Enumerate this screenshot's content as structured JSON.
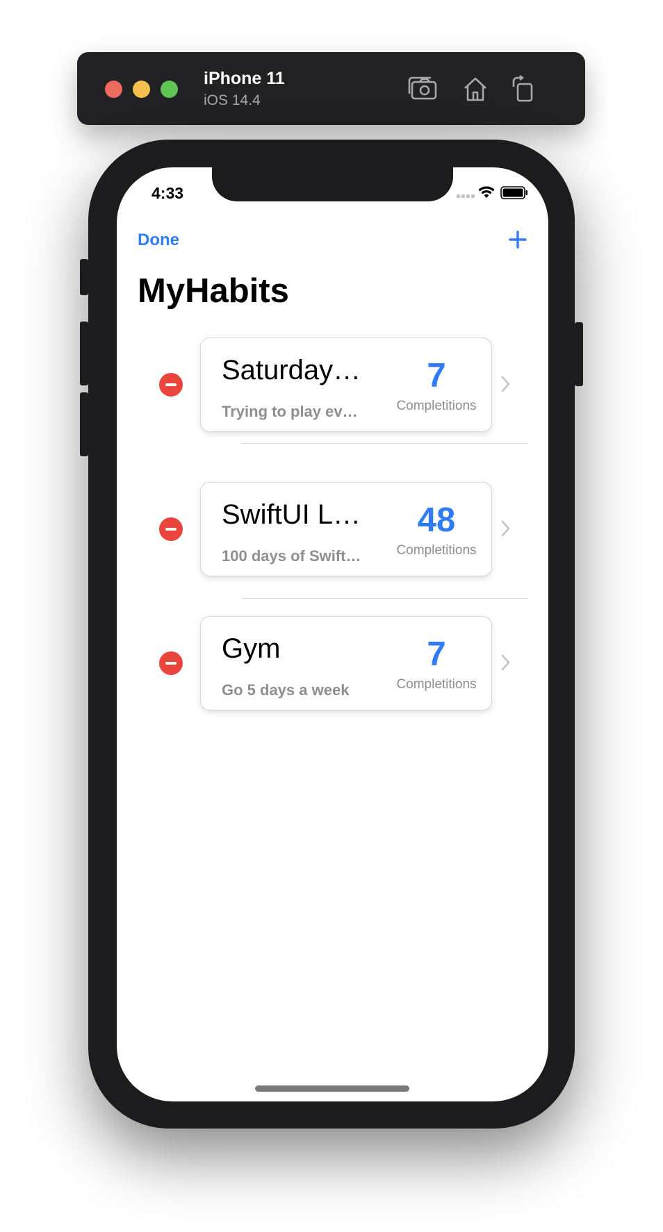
{
  "simulator": {
    "device_name": "iPhone 11",
    "os_version": "iOS 14.4",
    "buttons": [
      "screenshot-icon",
      "home-icon",
      "rotate-icon"
    ]
  },
  "status_bar": {
    "time": "4:33",
    "icons": [
      "cellular-dots-icon",
      "wifi-icon",
      "battery-icon"
    ]
  },
  "nav": {
    "done_label": "Done",
    "add_icon": "plus-icon",
    "title": "MyHabits"
  },
  "habits": [
    {
      "title": "Saturday…",
      "description": "Trying to play ev…",
      "count": "7",
      "count_label": "Completitions"
    },
    {
      "title": "SwiftUI L…",
      "description": "100 days of Swift…",
      "count": "48",
      "count_label": "Completitions"
    },
    {
      "title": "Gym",
      "description": "Go 5 days a week",
      "count": "7",
      "count_label": "Completitions"
    }
  ],
  "colors": {
    "accent": "#2f7cf6",
    "delete": "#e9453d",
    "secondary_text": "#8e8e93",
    "device_frame": "#1c1c1e"
  }
}
